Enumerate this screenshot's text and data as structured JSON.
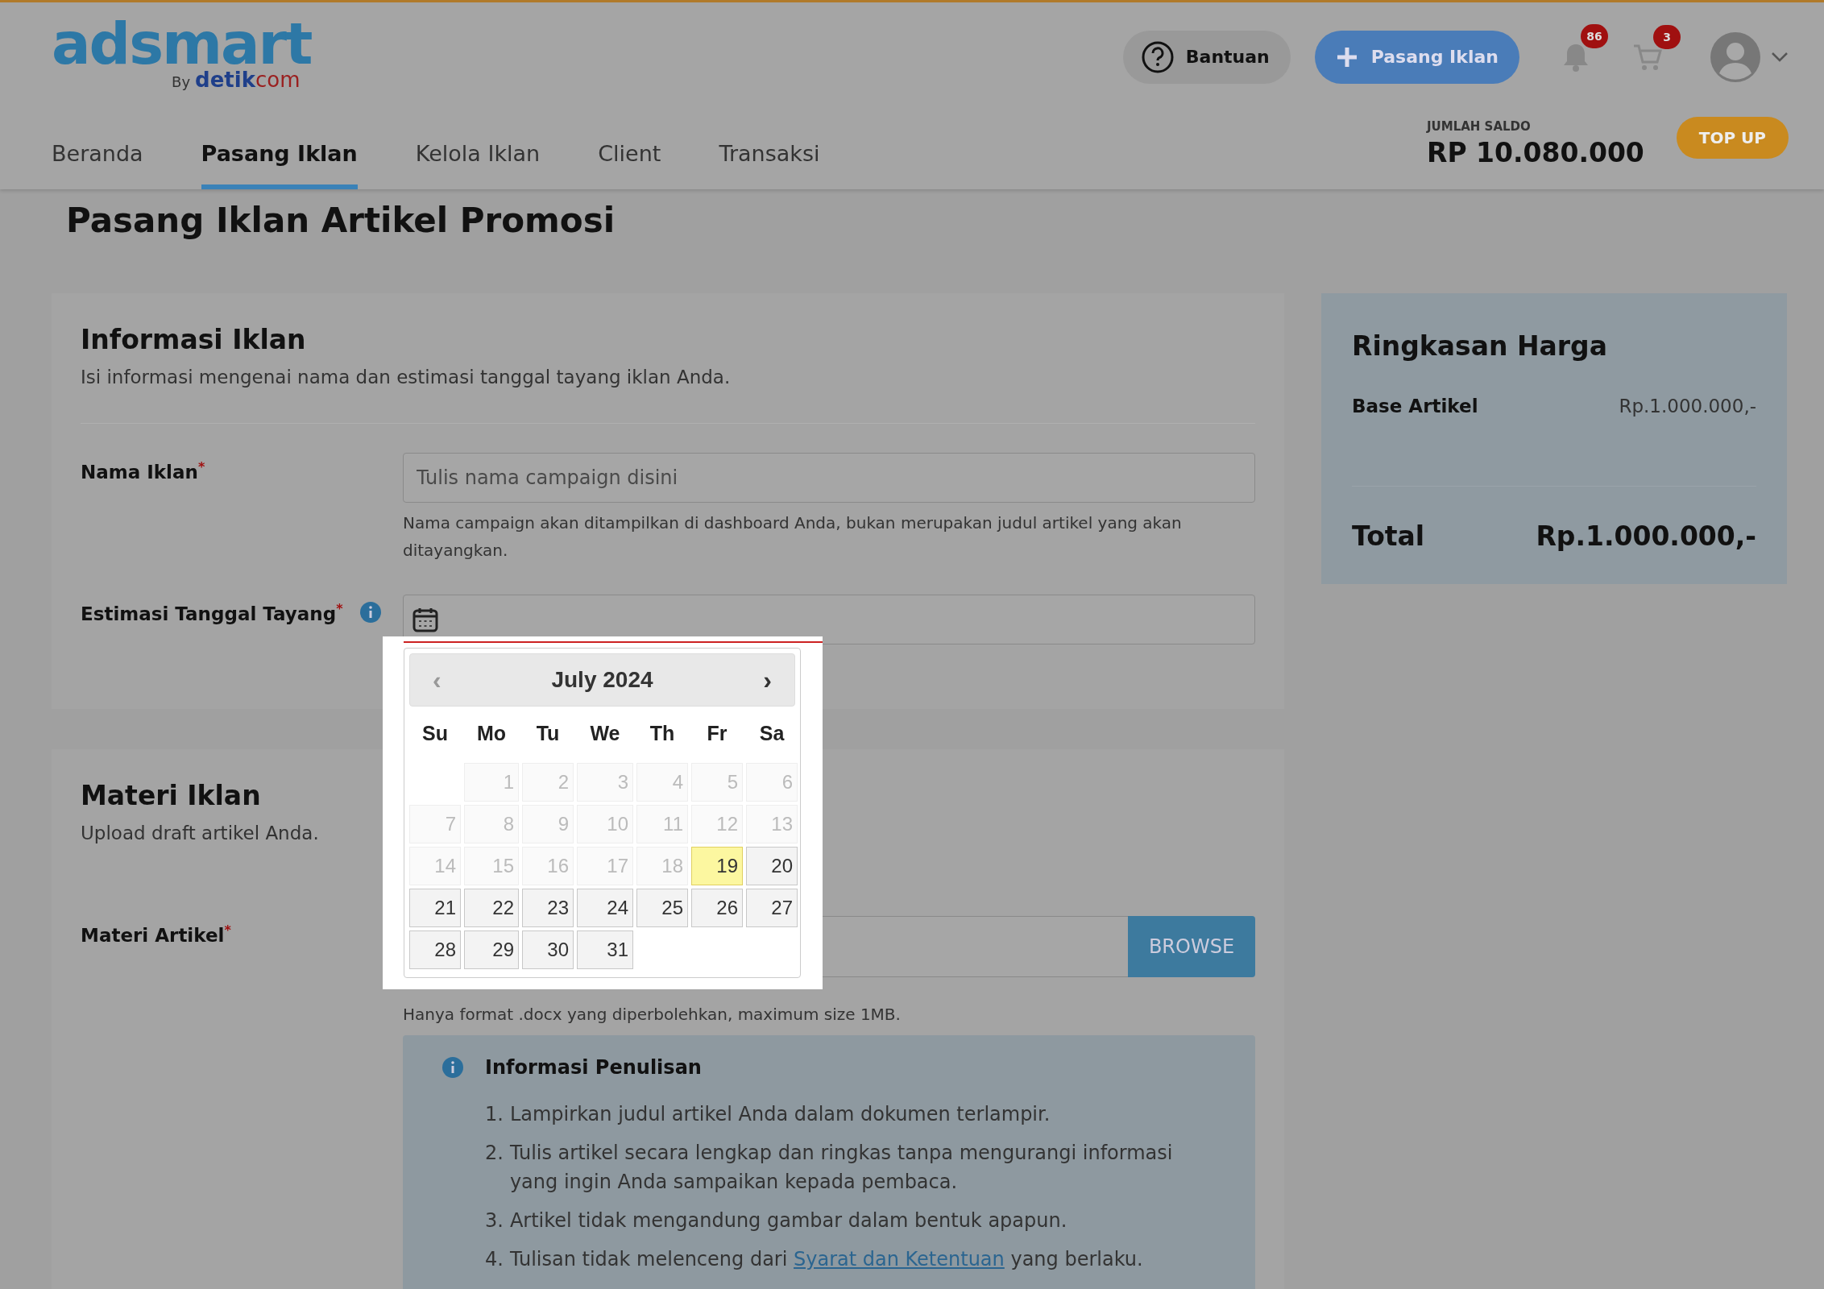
{
  "header": {
    "logo": {
      "name": "adsmart",
      "by": "By",
      "brand": "**detik**com"
    },
    "help_button": "Bantuan",
    "primary_button": "Pasang Iklan",
    "notifications": {
      "badge": "86"
    },
    "cart": {
      "badge": "3"
    },
    "nav": [
      {
        "label": "Beranda",
        "selected": false
      },
      {
        "label": "Pasang Iklan",
        "selected": true
      },
      {
        "label": "Kelola Iklan",
        "selected": false
      },
      {
        "label": "Client",
        "selected": false
      },
      {
        "label": "Transaksi",
        "selected": false
      }
    ],
    "balance": {
      "label": "JUMLAH SALDO",
      "value": "RP 10.080.000"
    },
    "topup_button": "TOP UP"
  },
  "page_title": "Pasang Iklan Artikel Promosi",
  "info_card": {
    "title": "Informasi Iklan",
    "description": "Isi informasi mengenai nama dan estimasi tanggal tayang iklan Anda.",
    "name_field": {
      "label": "Nama Iklan$^{*}$",
      "placeholder": "Tulis nama campaign disini",
      "help": "Nama campaign akan ditampilkan di dashboard Anda, bukan merupakan judul artikel yang akan ditayangkan."
    },
    "date_field": {
      "label": "Estimasi Tanggal Tayang$^{*}$"
    }
  },
  "datepicker": {
    "prev": "‹",
    "month": "July 2024",
    "next": "›",
    "weekdays": [
      "Su",
      "Mo",
      "Tu",
      "We",
      "Th",
      "Fr",
      "Sa"
    ],
    "weeks": [
      [
        {
          "label": "1",
          "disabled": true,
          "highlighted": false
        },
        {
          "label": "2",
          "disabled": true,
          "highlighted": false
        },
        {
          "label": "3",
          "disabled": true,
          "highlighted": false
        },
        {
          "label": "4",
          "disabled": true,
          "highlighted": false
        },
        {
          "label": "5",
          "disabled": true,
          "highlighted": false
        },
        {
          "label": "6",
          "disabled": true,
          "highlighted": false
        }
      ],
      [
        {
          "label": "7",
          "disabled": true,
          "highlighted": false
        },
        {
          "label": "8",
          "disabled": true,
          "highlighted": false
        },
        {
          "label": "9",
          "disabled": true,
          "highlighted": false
        },
        {
          "label": "10",
          "disabled": true,
          "highlighted": false
        },
        {
          "label": "11",
          "disabled": true,
          "highlighted": false
        },
        {
          "label": "12",
          "disabled": true,
          "highlighted": false
        },
        {
          "label": "13",
          "disabled": true,
          "highlighted": false
        }
      ],
      [
        {
          "label": "14",
          "disabled": true,
          "highlighted": false
        },
        {
          "label": "15",
          "disabled": true,
          "highlighted": false
        },
        {
          "label": "16",
          "disabled": true,
          "highlighted": false
        },
        {
          "label": "17",
          "disabled": true,
          "highlighted": false
        },
        {
          "label": "18",
          "disabled": true,
          "highlighted": false
        },
        {
          "label": "19",
          "disabled": false,
          "highlighted": true
        },
        {
          "label": "20",
          "disabled": false,
          "highlighted": false
        }
      ],
      [
        {
          "label": "21",
          "disabled": false,
          "highlighted": false
        },
        {
          "label": "22",
          "disabled": false,
          "highlighted": false
        },
        {
          "label": "23",
          "disabled": false,
          "highlighted": false
        },
        {
          "label": "24",
          "disabled": false,
          "highlighted": false
        },
        {
          "label": "25",
          "disabled": false,
          "highlighted": false
        },
        {
          "label": "26",
          "disabled": false,
          "highlighted": false
        },
        {
          "label": "27",
          "disabled": false,
          "highlighted": false
        }
      ],
      [
        {
          "label": "28",
          "disabled": false,
          "highlighted": false
        },
        {
          "label": "29",
          "disabled": false,
          "highlighted": false
        },
        {
          "label": "30",
          "disabled": false,
          "highlighted": false
        },
        {
          "label": "31",
          "disabled": false,
          "highlighted": false
        }
      ]
    ]
  },
  "material_card": {
    "title": "Materi Iklan",
    "description": "Upload draft artikel Anda.",
    "file_field": {
      "label": "Materi Artikel$^{*}$",
      "button": "BROWSE",
      "help": "Hanya format .docx yang diperbolehkan, maximum size 1MB."
    },
    "guidelines": {
      "title": "Informasi Penulisan",
      "items": [
        {
          "number": "1.",
          "text": "Lampirkan judul artikel Anda dalam dokumen terlampir."
        },
        {
          "number": "2.",
          "text": "Tulis artikel secara lengkap dan ringkas tanpa mengurangi informasi yang ingin Anda sampaikan kepada pembaca."
        },
        {
          "number": "3.",
          "text": "Artikel tidak mengandung gambar dalam bentuk apapun."
        },
        {
          "number": "4.",
          "text": "Tulisan tidak melenceng dari",
          "link": "Syarat dan Ketentuan",
          "text_after": "yang berlaku."
        }
      ]
    }
  },
  "summary": {
    "title": "Ringkasan Harga",
    "rows": [
      {
        "label": "Base Artikel",
        "value": "Rp.1.000.000,-"
      }
    ],
    "total_label": "Total",
    "total_value": "Rp.1.000.000,-"
  }
}
